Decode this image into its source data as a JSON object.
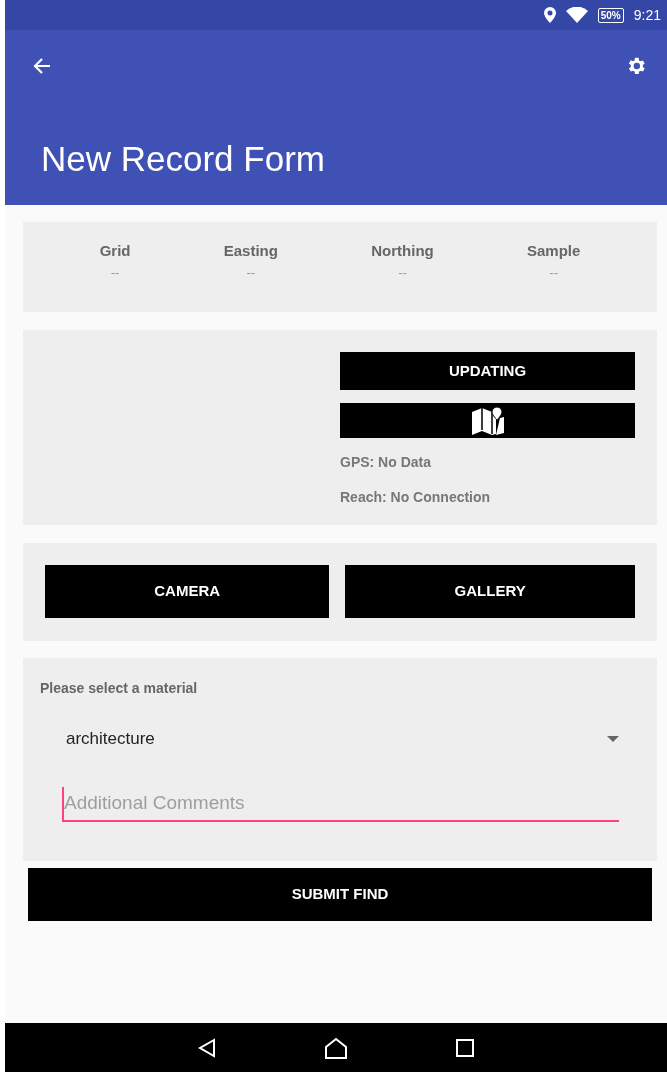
{
  "status_bar": {
    "battery": "50%",
    "time": "9:21"
  },
  "toolbar": {
    "title": "New Record Form"
  },
  "location_summary": [
    {
      "label": "Grid",
      "value": "--"
    },
    {
      "label": "Easting",
      "value": "--"
    },
    {
      "label": "Northing",
      "value": "--"
    },
    {
      "label": "Sample",
      "value": "--"
    }
  ],
  "gps_panel": {
    "update_button": "UPDATING",
    "gps_status": "GPS: No Data",
    "reach_status": "Reach: No Connection"
  },
  "photo_buttons": [
    "CAMERA",
    "GALLERY"
  ],
  "material": {
    "label": "Please select a material",
    "selected_value": "architecture"
  },
  "comments": {
    "placeholder": "Additional Comments",
    "focused": true
  },
  "submit_button": "SUBMIT FIND"
}
